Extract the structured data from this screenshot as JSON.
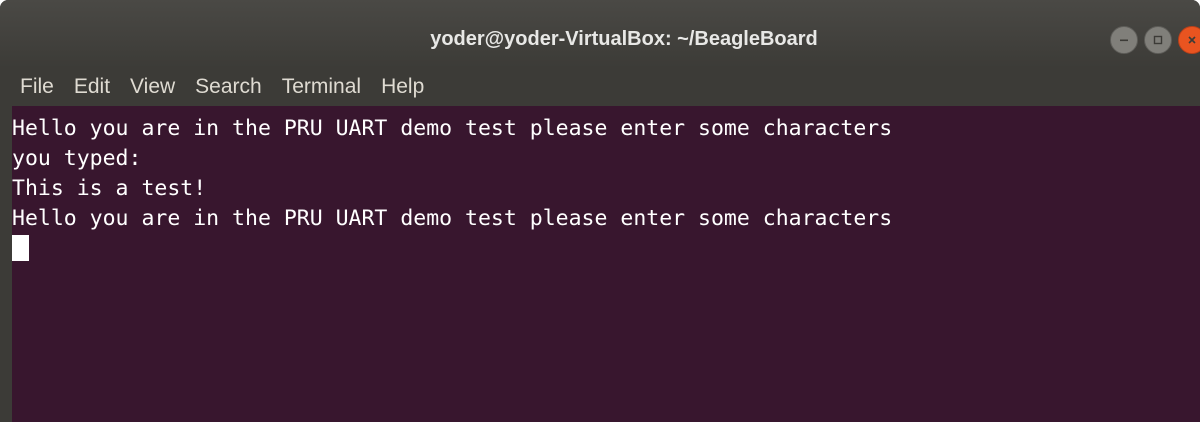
{
  "window": {
    "title": "yoder@yoder-VirtualBox: ~/BeagleBoard",
    "controls": [
      "minimize-icon",
      "maximize-icon",
      "close-icon"
    ]
  },
  "menubar": {
    "items": [
      {
        "label": "File"
      },
      {
        "label": "Edit"
      },
      {
        "label": "View"
      },
      {
        "label": "Search"
      },
      {
        "label": "Terminal"
      },
      {
        "label": "Help"
      }
    ]
  },
  "terminal": {
    "lines": [
      "Hello you are in the PRU UART demo test please enter some characters",
      "you typed:",
      "This is a test!",
      "Hello you are in the PRU UART demo test please enter some characters"
    ],
    "background": "#38162e",
    "foreground": "#ffffff"
  },
  "colors": {
    "titlebar": "#3c3b37",
    "close_button": "#e95420",
    "other_buttons": "#807f7a"
  }
}
